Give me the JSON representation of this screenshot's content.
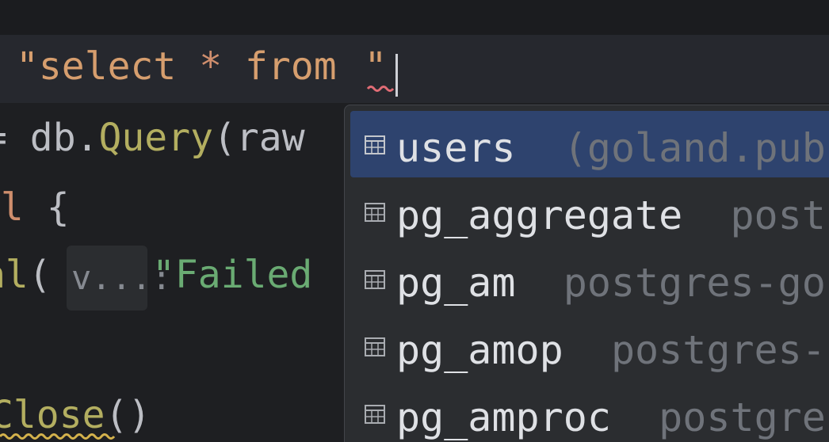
{
  "editor": {
    "line1": {
      "open_quote": "\"",
      "sql_select": "select",
      "sql_star": "*",
      "sql_from": "from",
      "space_tail": " ",
      "close_quote": "\""
    },
    "line2": {
      "prefix": "= ",
      "receiver": "db",
      "dot": ".",
      "method": "Query",
      "paren_arg": "(raw"
    },
    "line3": {
      "keyword_tail": "il",
      "brace": " {"
    },
    "line4": {
      "fn_tail": "al",
      "paren": "(",
      "hint_label": "v...:",
      "string": "\"Failed"
    },
    "line5": {
      "method": "Close",
      "parens": "()"
    }
  },
  "autocomplete": {
    "items": [
      {
        "name": "users",
        "source": "(goland.pub",
        "selected": true,
        "icon": "table-icon"
      },
      {
        "name": "pg_aggregate",
        "source": "post",
        "selected": false,
        "icon": "table-icon"
      },
      {
        "name": "pg_am",
        "source": "postgres-go",
        "selected": false,
        "icon": "table-icon"
      },
      {
        "name": "pg_amop",
        "source": "postgres-",
        "selected": false,
        "icon": "table-icon"
      },
      {
        "name": "pg_amproc",
        "source": "postgre",
        "selected": false,
        "icon": "table-icon"
      }
    ]
  },
  "colors": {
    "background": "#1e1f22",
    "selection": "#2e436e",
    "string": "#6aab73",
    "keyword": "#cf8e6d",
    "function": "#b3ae60",
    "error_squiggle": "#e06c75",
    "warning_squiggle": "#d4b24c"
  }
}
